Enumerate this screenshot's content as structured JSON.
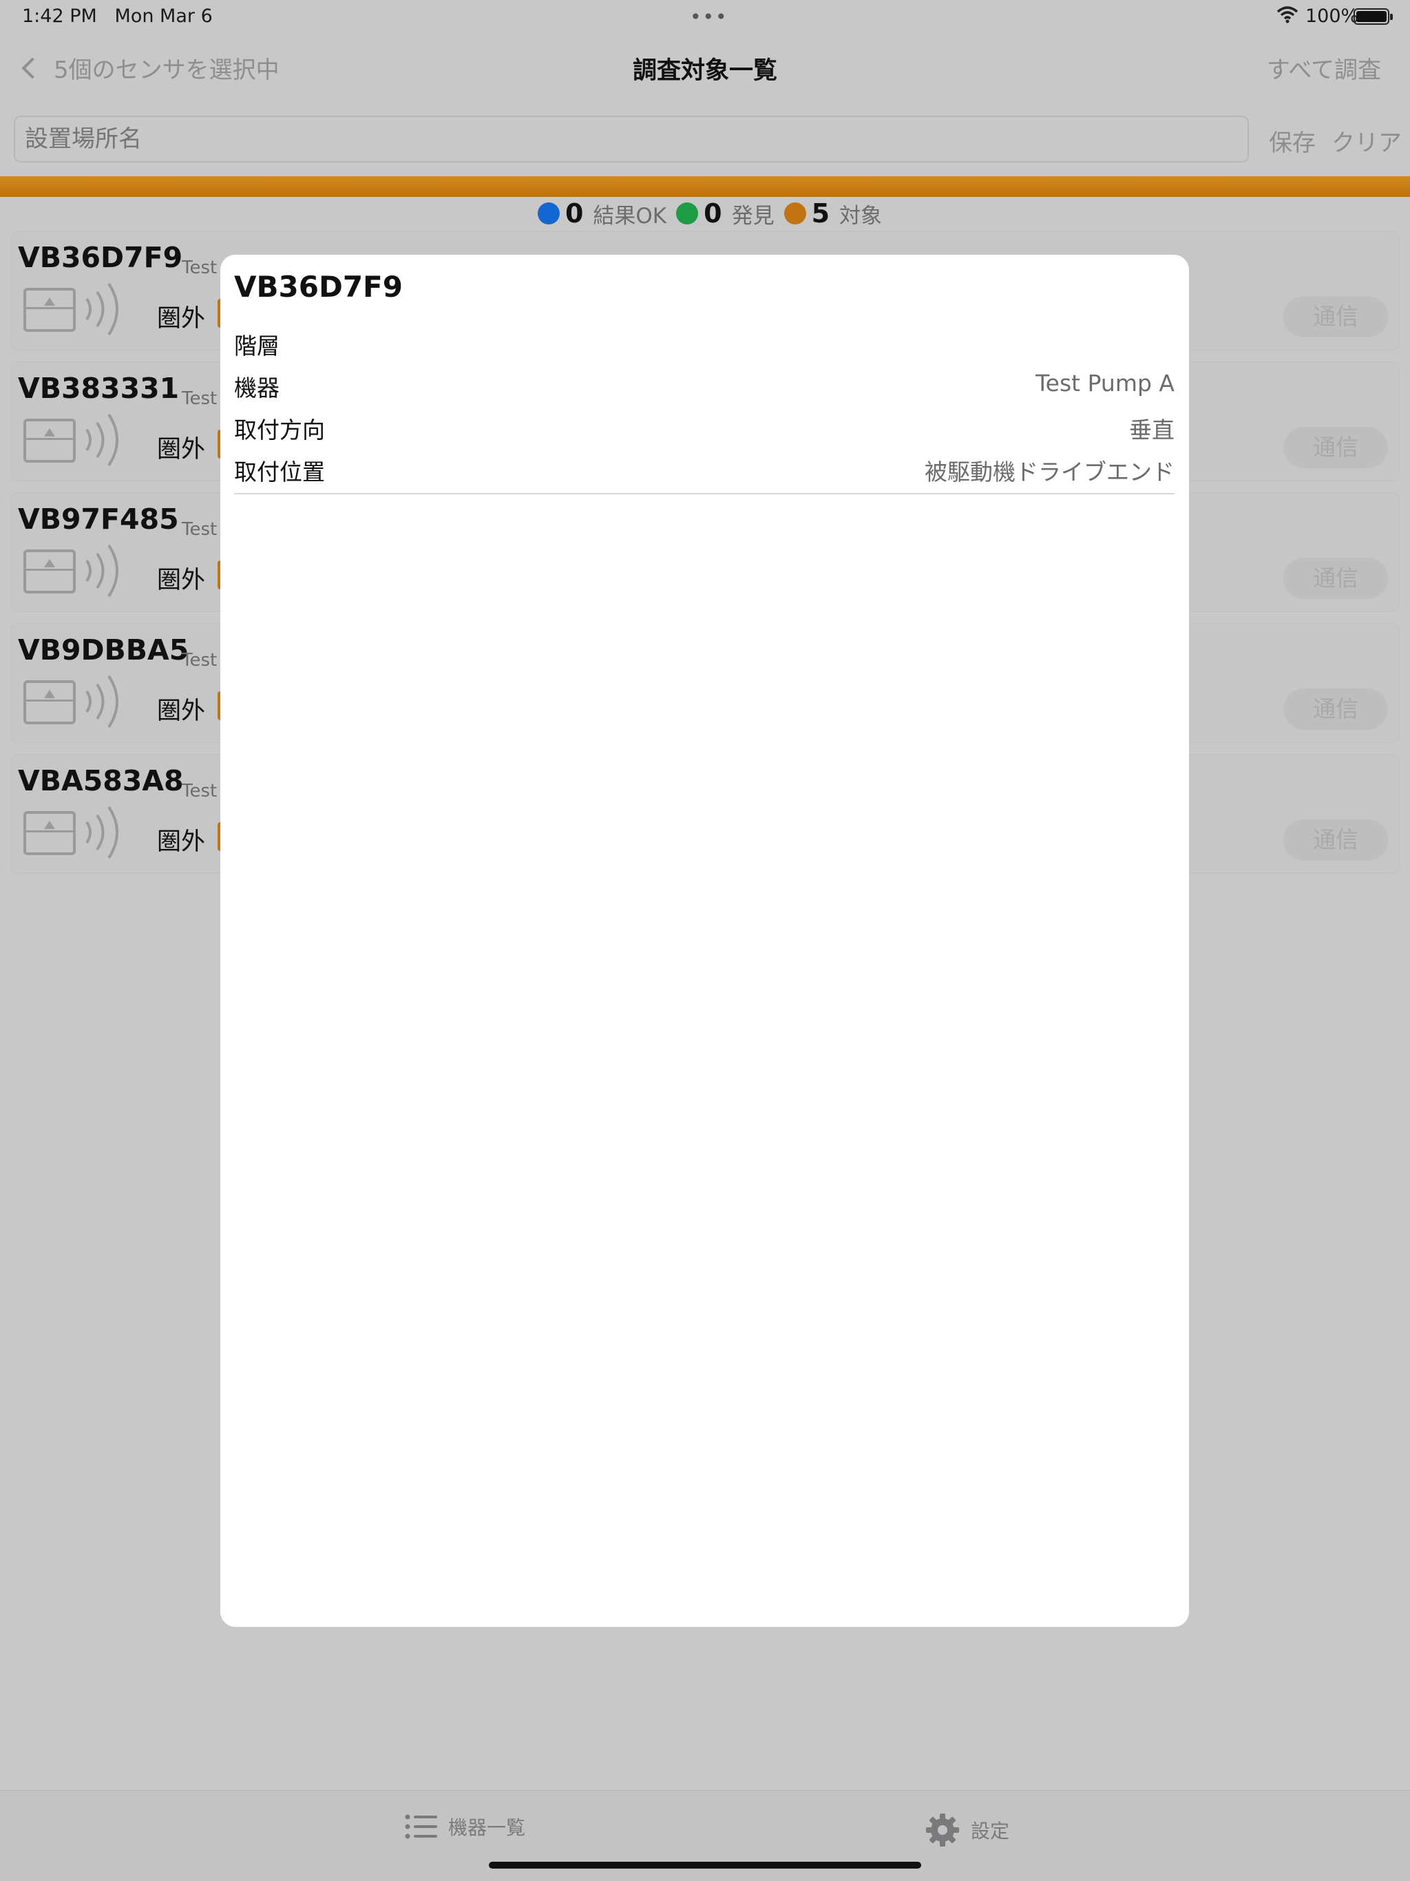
{
  "status_bar": {
    "time": "1:42 PM",
    "date": "Mon Mar 6",
    "multitask_dots": "•••",
    "battery": "100%"
  },
  "nav": {
    "back_label": "5個のセンサを選択中",
    "title": "調査対象一覧",
    "right_label": "すべて調査"
  },
  "search": {
    "placeholder": "設置場所名",
    "save_label": "保存",
    "clear_label": "クリア"
  },
  "summary": {
    "ok_count": "0",
    "ok_label": "結果OK",
    "found_count": "0",
    "found_label": "発見",
    "target_count": "5",
    "target_label": "対象",
    "colors": {
      "ok": "#1467d0",
      "found": "#1e9b45",
      "target": "#c27412"
    }
  },
  "sensors": [
    {
      "id": "VB36D7F9",
      "sub": "Test",
      "status": "圏外",
      "button": "通信"
    },
    {
      "id": "VB383331",
      "sub": "Test",
      "status": "圏外",
      "button": "通信"
    },
    {
      "id": "VB97F485",
      "sub": "Test",
      "status": "圏外",
      "button": "通信"
    },
    {
      "id": "VB9DBBA5",
      "sub": "Test",
      "status": "圏外",
      "button": "通信"
    },
    {
      "id": "VBA583A8",
      "sub": "Test",
      "status": "圏外",
      "button": "通信"
    }
  ],
  "modal": {
    "title": "VB36D7F9",
    "rows": [
      {
        "label": "階層",
        "value": ""
      },
      {
        "label": "機器",
        "value": "Test Pump A"
      },
      {
        "label": "取付方向",
        "value": "垂直"
      },
      {
        "label": "取付位置",
        "value": "被駆動機ドライブエンド"
      }
    ]
  },
  "tabs": {
    "list_label": "機器一覧",
    "list_icon": "list-icon",
    "settings_label": "設定",
    "settings_icon": "gear-icon"
  }
}
